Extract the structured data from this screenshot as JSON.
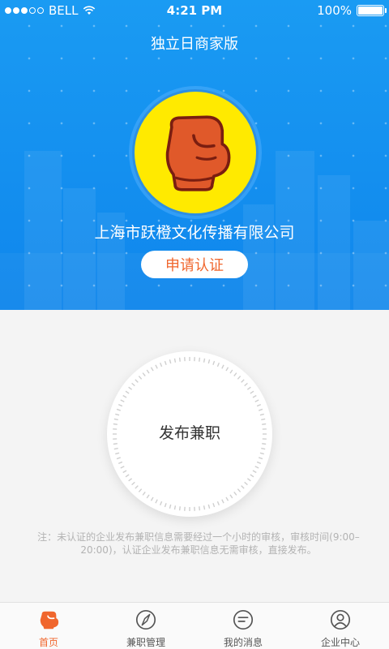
{
  "status_bar": {
    "carrier": "BELL",
    "time": "4:21 PM",
    "battery": "100%",
    "battery_level": 1.0,
    "signal_filled": 3,
    "signal_total": 5
  },
  "header": {
    "title": "独立日商家版",
    "company_name": "上海市跃橙文化传播有限公司",
    "cert_button": "申请认证",
    "logo_icon": "boxing-glove-icon"
  },
  "publish": {
    "label": "发布兼职"
  },
  "note": "注：未认证的企业发布兼职信息需要经过一个小时的审核，审核时间(9:00–20:00)，认证企业发布兼职信息无需审核，直接发布。",
  "tabs": [
    {
      "label": "首页",
      "icon": "home-glove-icon",
      "active": true
    },
    {
      "label": "兼职管理",
      "icon": "compass-icon",
      "active": false
    },
    {
      "label": "我的消息",
      "icon": "message-icon",
      "active": false
    },
    {
      "label": "企业中心",
      "icon": "profile-icon",
      "active": false
    }
  ],
  "colors": {
    "header_blue": "#1a9bf3",
    "accent_orange": "#f0662d",
    "logo_yellow": "#ffea00",
    "glove_red": "#e0592a"
  }
}
